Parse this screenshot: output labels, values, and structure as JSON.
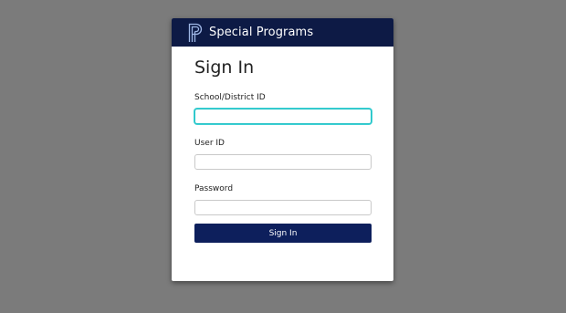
{
  "header": {
    "brand": "Special Programs",
    "logo_icon": "powerschool-p-logo-icon"
  },
  "form": {
    "title": "Sign In",
    "fields": [
      {
        "label": "School/District ID",
        "value": "",
        "placeholder": ""
      },
      {
        "label": "User ID",
        "value": "",
        "placeholder": ""
      },
      {
        "label": "Password",
        "value": "",
        "placeholder": ""
      }
    ],
    "submit_label": "Sign In"
  },
  "colors": {
    "header_bg": "#0d1a45",
    "button_bg": "#0d1f5c",
    "focus_ring": "#26c3c7",
    "page_bg": "#7b7b7b"
  }
}
